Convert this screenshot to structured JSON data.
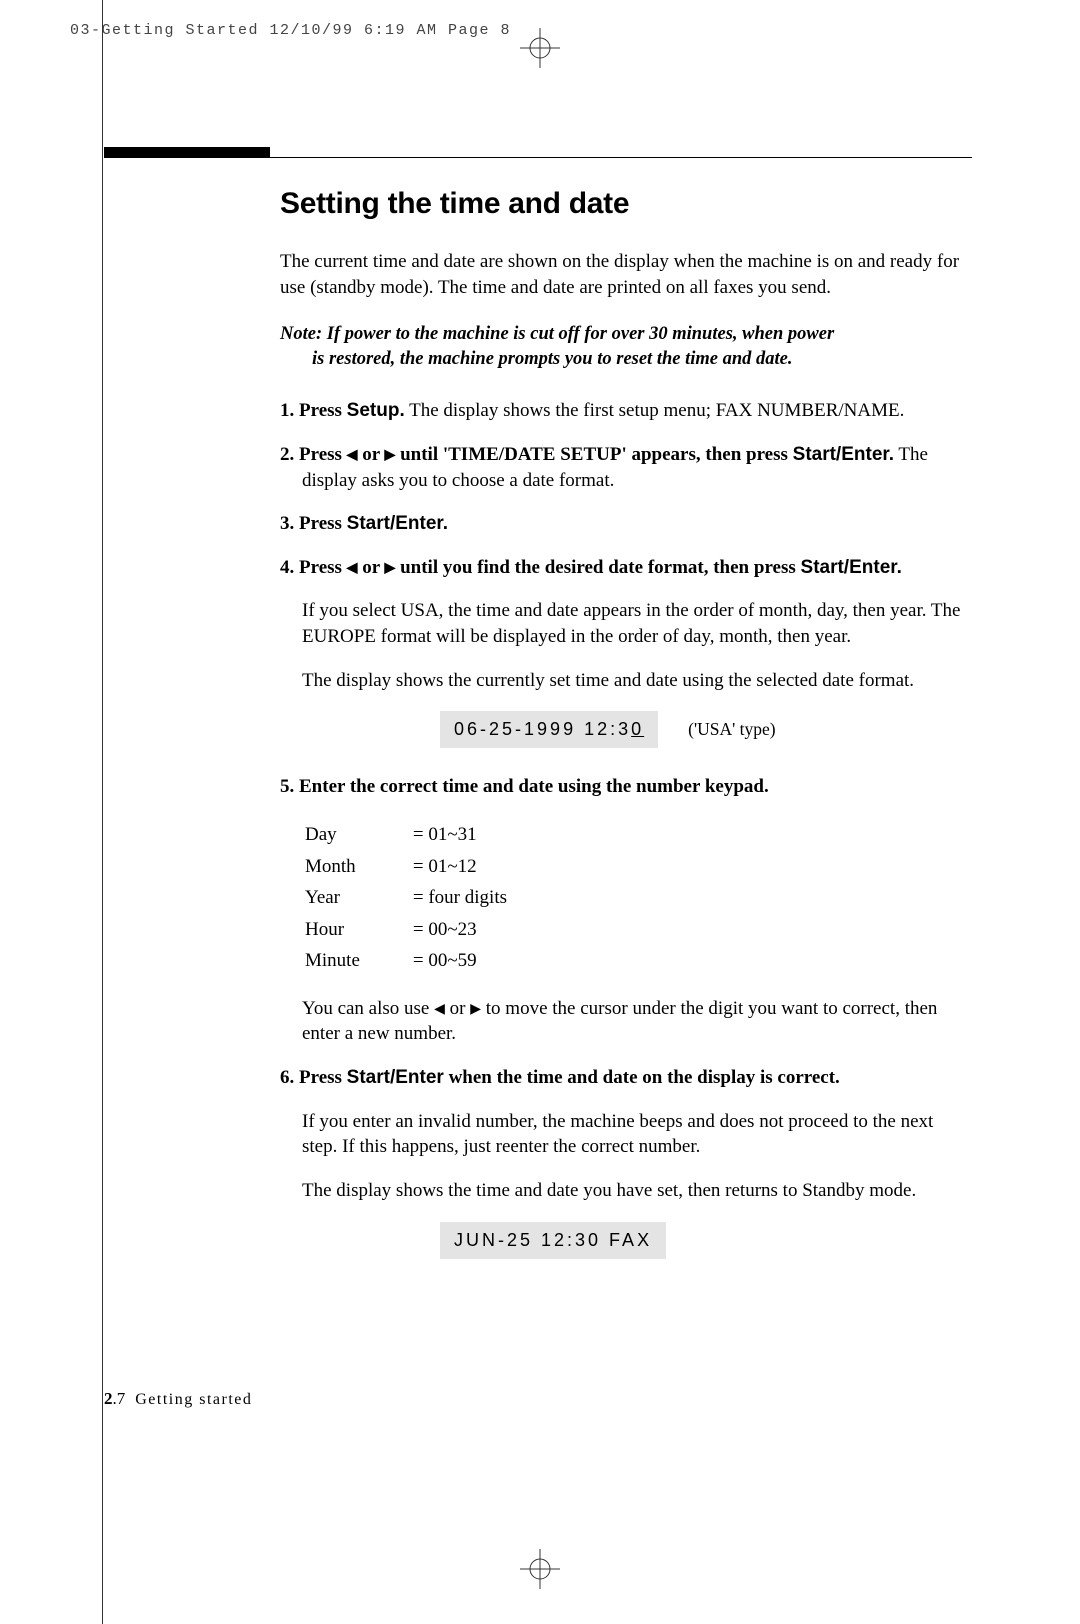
{
  "crop_header": "03-Getting Started  12/10/99 6:19 AM  Page 8",
  "heading": "Setting the time and date",
  "intro": "The current time and date are shown on the display when the machine is on and ready for use (standby mode). The time and date are printed on all faxes you send.",
  "note_line1": "Note: If power to the machine is cut off for over 30 minutes, when power",
  "note_line2": "is restored, the machine prompts you to reset the time and date.",
  "step1_prefix": "1. Press ",
  "step1_button": "Setup.",
  "step1_rest": " The display shows the first setup menu; FAX NUMBER/NAME.",
  "step2_prefix": "2. Press ",
  "step2_mid": " or ",
  "step2_after": " until 'TIME/DATE SETUP' appears, then press ",
  "step2_btn2": "Start/Enter.",
  "step2_rest2": " The display asks you to choose a date format.",
  "step3_prefix": "3. Press ",
  "step3_button": "Start/Enter.",
  "step4_prefix": "4. Press ",
  "step4_mid": " or ",
  "step4_after": " until you find the desired date format, then press ",
  "step4_btn": "Start/Enter.",
  "step4_body1": "If you select USA, the time and date appears in the order of month, day, then year. The EUROPE format will be displayed in the order of day, month, then year.",
  "step4_body2": "The display shows the currently set time and date using the selected date format.",
  "lcd1_main": "06-25-1999 12:3",
  "lcd1_under": "0",
  "lcd1_label": "('USA' type)",
  "step5": "5. Enter the correct time and date using the number keypad.",
  "ranges": {
    "r1a": "Day",
    "r1b": "= 01~31",
    "r2a": "Month",
    "r2b": "= 01~12",
    "r3a": "Year",
    "r3b": "= four digits",
    "r4a": "Hour",
    "r4b": "= 00~23",
    "r5a": "Minute",
    "r5b": "= 00~59"
  },
  "step5_body_a": "You can also use ",
  "step5_body_mid": " or ",
  "step5_body_b": " to move the cursor under the digit you want to correct, then enter a new number.",
  "step6_prefix": "6. Press ",
  "step6_btn": "Start/Enter",
  "step6_after": " when the time and date on the display is correct.",
  "step6_body1": "If you enter an invalid number, the machine beeps and does not proceed to the next step. If this happens, just reenter the correct number.",
  "step6_body2": "The display shows the time and date you have set, then returns to Standby mode.",
  "lcd2": "JUN-25 12:30 FAX",
  "footer_num": "2",
  "footer_sub": ".7",
  "footer_label": "Getting started",
  "arrow_left": "◀",
  "arrow_right": "▶"
}
